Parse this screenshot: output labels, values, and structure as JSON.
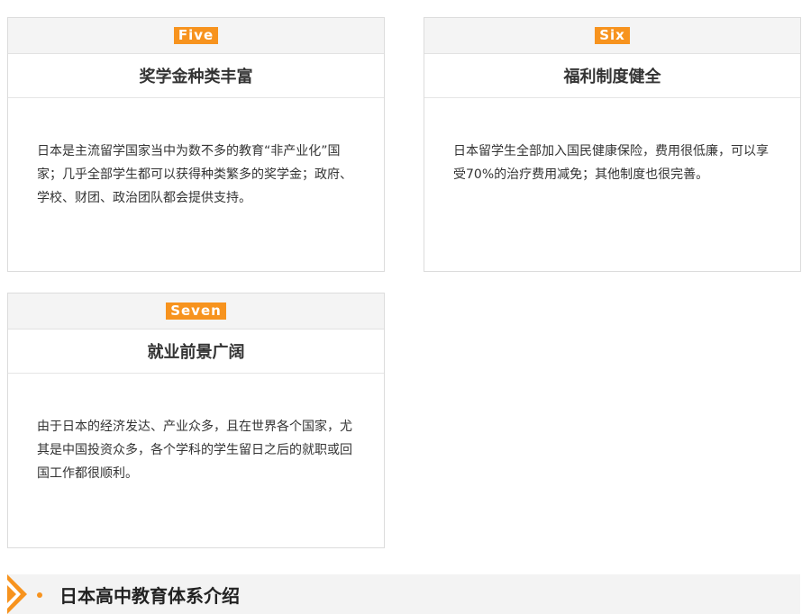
{
  "cards": [
    {
      "number": "Five",
      "title": "奖学金种类丰富",
      "body": "日本是主流留学国家当中为数不多的教育“非产业化”国家；几乎全部学生都可以获得种类繁多的奖学金；政府、学校、财团、政治团队都会提供支持。"
    },
    {
      "number": "Six",
      "title": "福利制度健全",
      "body": "日本留学生全部加入国民健康保险，费用很低廉，可以享受70%的治疗费用减免；其他制度也很完善。"
    },
    {
      "number": "Seven",
      "title": "就业前景广阔",
      "body": "由于日本的经济发达、产业众多，且在世界各个国家，尤其是中国投资众多，各个学科的学生留日之后的就职或回国工作都很顺利。"
    }
  ],
  "section": {
    "title": "日本高中教育体系介绍"
  },
  "colors": {
    "accent": "#f7931e",
    "header_bg": "#f4f4f4",
    "border": "#dcdcdc"
  }
}
